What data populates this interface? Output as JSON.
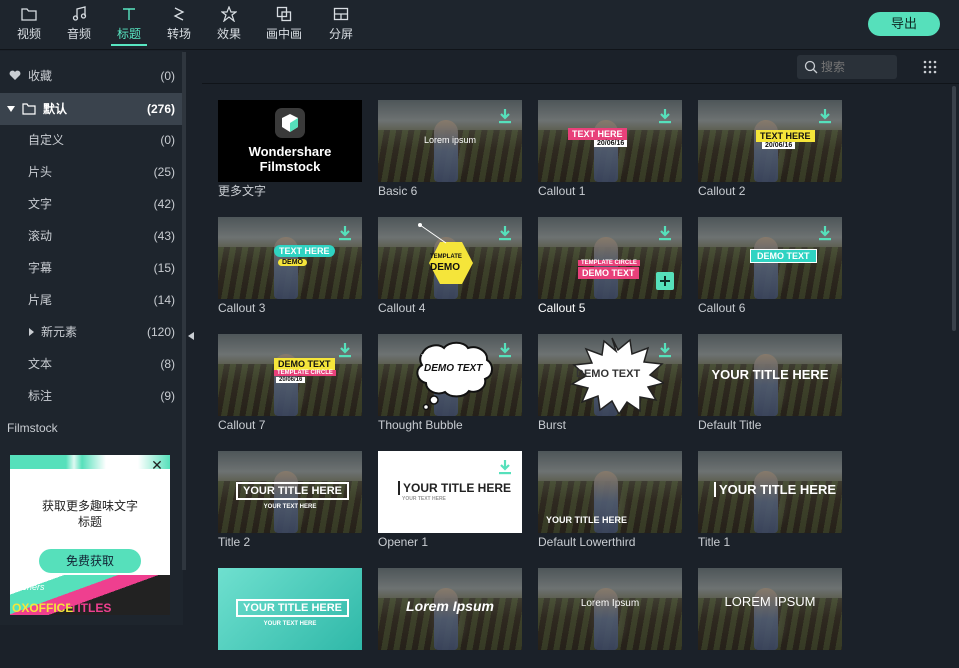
{
  "tabs": [
    {
      "label": "视频",
      "icon": "folder-icon"
    },
    {
      "label": "音频",
      "icon": "music-note-icon"
    },
    {
      "label": "标题",
      "icon": "text-t-icon",
      "active": true
    },
    {
      "label": "转场",
      "icon": "transition-icon"
    },
    {
      "label": "效果",
      "icon": "effects-icon"
    },
    {
      "label": "画中画",
      "icon": "pip-icon"
    },
    {
      "label": "分屏",
      "icon": "split-screen-icon"
    }
  ],
  "export_label": "导出",
  "search": {
    "placeholder": "搜索"
  },
  "sidebar": {
    "favorites": {
      "label": "收藏",
      "count": "(0)"
    },
    "default": {
      "label": "默认",
      "count": "(276)"
    },
    "items": [
      {
        "label": "自定义",
        "count": "(0)"
      },
      {
        "label": "片头",
        "count": "(25)"
      },
      {
        "label": "文字",
        "count": "(42)"
      },
      {
        "label": "滚动",
        "count": "(43)"
      },
      {
        "label": "字幕",
        "count": "(15)"
      },
      {
        "label": "片尾",
        "count": "(14)"
      },
      {
        "label": "新元素",
        "count": "(120)"
      },
      {
        "label": "文本",
        "count": "(8)"
      },
      {
        "label": "标注",
        "count": "(9)"
      }
    ],
    "filmstock": "Filmstock"
  },
  "promo": {
    "line1": "获取更多趣味文字",
    "line2": "标题",
    "button": "免费获取",
    "close": "✕",
    "img1": "openers",
    "img2": "OXOFFICE",
    "img3": "TITLES"
  },
  "cards": [
    {
      "title": "更多文字",
      "logo_line1": "Wondershare",
      "logo_line2": "Filmstock"
    },
    {
      "title": "Basic 6",
      "overlay": "Lorem ipsum"
    },
    {
      "title": "Callout 1",
      "overlay": "TEXT HERE",
      "sub": "20/06/16"
    },
    {
      "title": "Callout 2",
      "overlay": "TEXT HERE",
      "sub": "20/06/16"
    },
    {
      "title": "Callout 3",
      "overlay": "TEXT HERE",
      "sub": "DEMO"
    },
    {
      "title": "Callout 4",
      "overlay": "DEMO",
      "sub": "TEMPLATE"
    },
    {
      "title": "Callout 5",
      "overlay": "DEMO TEXT",
      "sub": "TEMPLATE CIRCLE"
    },
    {
      "title": "Callout 6",
      "overlay": "DEMO TEXT"
    },
    {
      "title": "Callout 7",
      "overlay": "DEMO TEXT",
      "sub": "TEMPLATE CIRCLE",
      "sub2": "20/06/16"
    },
    {
      "title": "Thought Bubble",
      "overlay": "DEMO TEXT"
    },
    {
      "title": "Burst",
      "overlay": "DEMO TEXT"
    },
    {
      "title": "Default Title",
      "overlay": "YOUR TITLE HERE"
    },
    {
      "title": "Title 2",
      "overlay": "YOUR TITLE HERE",
      "sub": "YOUR TEXT HERE"
    },
    {
      "title": "Opener 1",
      "overlay": "YOUR TITLE HERE",
      "sub": "YOUR TEXT HERE"
    },
    {
      "title": "Default Lowerthird",
      "overlay": "YOUR TITLE HERE"
    },
    {
      "title": "Title 1",
      "overlay": "YOUR TITLE HERE"
    },
    {
      "title": "",
      "overlay": "YOUR TITLE HERE",
      "sub": "YOUR TEXT HERE"
    },
    {
      "title": "",
      "overlay": "Lorem Ipsum"
    },
    {
      "title": "",
      "overlay": "Lorem Ipsum"
    },
    {
      "title": "",
      "overlay": "LOREM IPSUM"
    }
  ],
  "colors": {
    "accent": "#56e0bb",
    "pink": "#e8417a",
    "yellow": "#f5e53a",
    "teal": "#2fd3c2"
  }
}
